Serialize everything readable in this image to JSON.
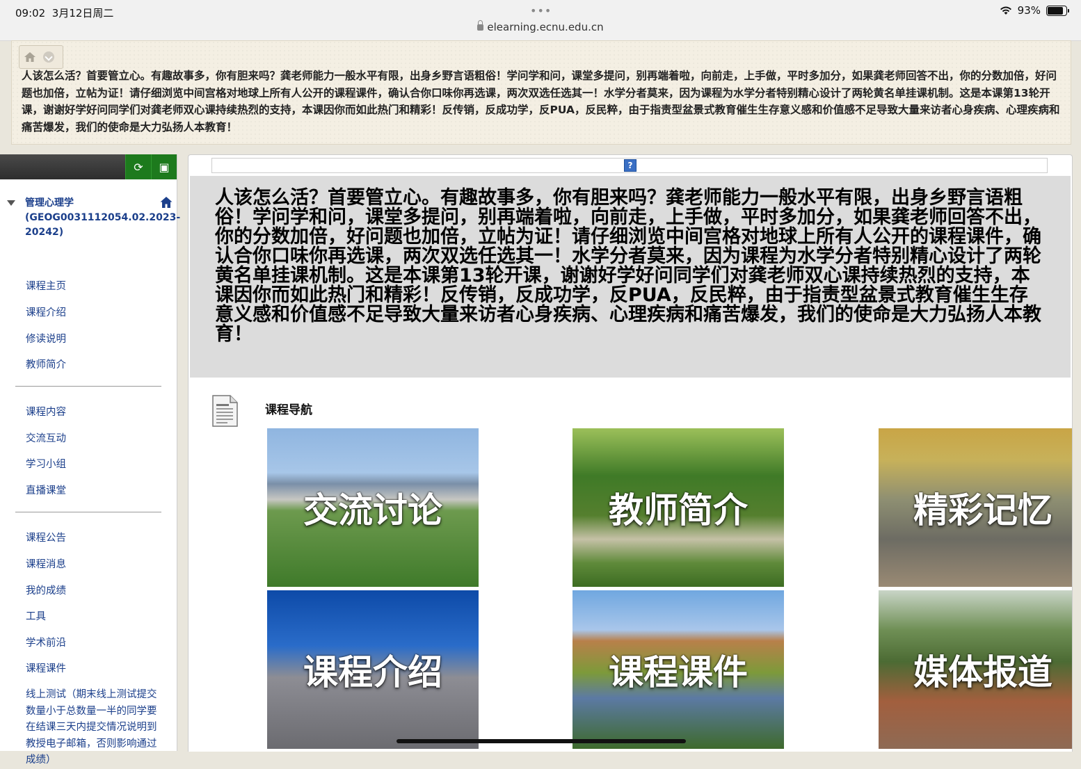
{
  "status_bar": {
    "time": "09:02",
    "date": "3月12日周二",
    "dots": "•••",
    "url": "elearning.ecnu.edu.cn",
    "battery": "93%",
    "battery_level": 0.93
  },
  "header": {
    "text": "人该怎么活？首要管立心。有趣故事多，你有胆来吗？龚老师能力一般水平有限，出身乡野言语粗俗！学问学和问，课堂多提问，别再端着啦，向前走，上手做，平时多加分，如果龚老师回答不出，你的分数加倍，好问题也加倍，立帖为证！请仔细浏览中间宫格对地球上所有人公开的课程课件，确认合你口味你再选课，两次双选任选其一！水学分者莫来，因为课程为水学分者特别精心设计了两轮黄名单挂课机制。这是本课第13轮开课，谢谢好学好问同学们对龚老师双心课持续热烈的支持，本课因你而如此热门和精彩！反传销，反成功学，反PUA，反民粹，由于指责型盆景式教育催生生存意义感和价值感不足导致大量来访者心身疾病、心理疾病和痛苦爆发，我们的使命是大力弘扬人本教育！"
  },
  "sidebar": {
    "course_title": "管理心理学(GEOG0031112054.02.2023-20242)",
    "group1": [
      "课程主页",
      "课程介绍",
      "修读说明",
      "教师简介"
    ],
    "group2": [
      "课程内容",
      "交流互动",
      "学习小组",
      "直播课堂"
    ],
    "group3": [
      "课程公告",
      "课程消息",
      "我的成绩",
      "工具",
      "学术前沿",
      "课程课件",
      "线上测试（期末线上测试提交数量小于总数量一半的同学要在结课三天内提交情况说明到教授电子邮箱，否则影响通过成绩）"
    ]
  },
  "main": {
    "help_icon": "?",
    "banner_text": "人该怎么活？首要管立心。有趣故事多，你有胆来吗？龚老师能力一般水平有限，出身乡野言语粗俗！学问学和问，课堂多提问，别再端着啦，向前走，上手做，平时多加分，如果龚老师回答不出，你的分数加倍，好问题也加倍，立帖为证！请仔细浏览中间宫格对地球上所有人公开的课程课件，确认合你口味你再选课，两次双选任选其一！水学分者莫来，因为课程为水学分者特别精心设计了两轮黄名单挂课机制。这是本课第13轮开课，谢谢好学好问同学们对龚老师双心课持续热烈的支持，本课因你而如此热门和精彩！反传销，反成功学，反PUA，反民粹，由于指责型盆景式教育催生生存意义感和价值感不足导致大量来访者心身疾病、心理疾病和痛苦爆发，我们的使命是大力弘扬人本教育！",
    "nav_title": "课程导航",
    "tiles": [
      "交流讨论",
      "教师简介",
      "精彩记忆",
      "课程介绍",
      "课程课件",
      "媒体报道"
    ]
  }
}
